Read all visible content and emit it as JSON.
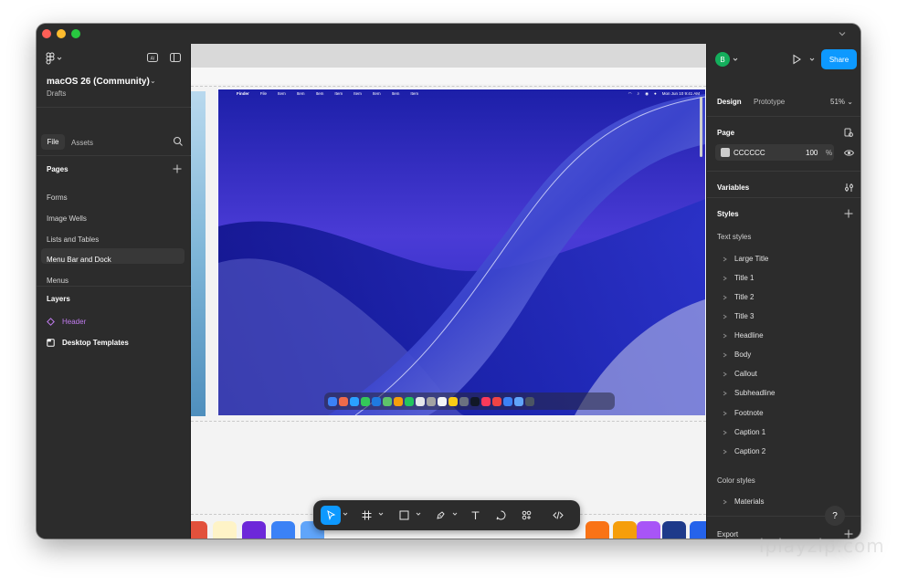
{
  "left_panel": {
    "project_title": "macOS 26 (Community)",
    "project_subtitle": "Drafts",
    "tabs": [
      "File",
      "Assets"
    ],
    "pages_title": "Pages",
    "pages": [
      "Forms",
      "Image Wells",
      "Lists and Tables",
      "Menu Bar and Dock",
      "Menus"
    ],
    "selected_page": "Menu Bar and Dock",
    "layers_title": "Layers",
    "layers": [
      {
        "label": "Header",
        "color": "#c27cf0"
      },
      {
        "label": "Desktop Templates",
        "color": "#ffffff"
      }
    ]
  },
  "canvas": {
    "menubar_items": [
      "Finder",
      "File",
      "Item",
      "Item",
      "Item",
      "Item",
      "Item",
      "Item",
      "Item",
      "Item"
    ],
    "menubar_clock": "Mon Jun 10  9:41 AM"
  },
  "right_panel": {
    "avatar_initial": "B",
    "share_label": "Share",
    "tabs": [
      "Design",
      "Prototype"
    ],
    "active_tab": "Design",
    "zoom": "51%",
    "page_section": "Page",
    "page_fill_hex": "CCCCCC",
    "page_fill_opacity": "100",
    "page_fill_unit": "%",
    "variables_section": "Variables",
    "styles_section": "Styles",
    "text_styles_header": "Text styles",
    "text_styles": [
      "Large Title",
      "Title 1",
      "Title 2",
      "Title 3",
      "Headline",
      "Body",
      "Callout",
      "Subheadline",
      "Footnote",
      "Caption 1",
      "Caption 2"
    ],
    "color_styles_header": "Color styles",
    "color_styles": [
      "Materials"
    ],
    "export_section": "Export",
    "help_label": "?"
  },
  "watermark": "iplayzip.com",
  "colors": {
    "accent": "#0d99ff",
    "panel_bg": "#2c2c2c",
    "avatar": "#14ae5c"
  }
}
